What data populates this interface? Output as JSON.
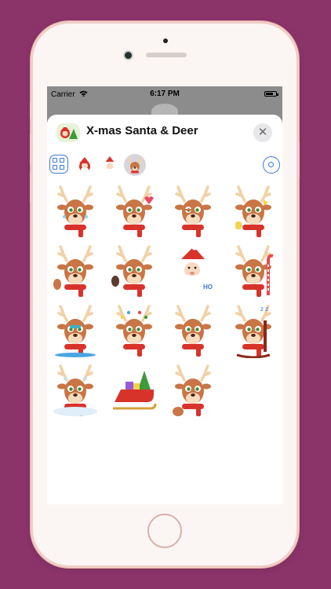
{
  "status": {
    "carrier": "Carrier",
    "time": "6:17 PM"
  },
  "app": {
    "title": "X-mas Santa & Deer",
    "close_glyph": "✕"
  },
  "toolbar": {
    "packs": [
      {
        "name": "santa-pack-icon",
        "selected": false
      },
      {
        "name": "santa-face-pack-icon",
        "selected": false
      },
      {
        "name": "deer-pack-icon",
        "selected": true
      }
    ]
  },
  "stickers": [
    {
      "variant": "deer-crying"
    },
    {
      "variant": "deer-kiss"
    },
    {
      "variant": "deer-wink"
    },
    {
      "variant": "deer-thumbs-up"
    },
    {
      "variant": "deer-waving"
    },
    {
      "variant": "deer-waving-alt"
    },
    {
      "variant": "santa-ho-ho"
    },
    {
      "variant": "deer-candy-cane"
    },
    {
      "variant": "deer-snowboarding"
    },
    {
      "variant": "deer-lights"
    },
    {
      "variant": "deer-scarf"
    },
    {
      "variant": "deer-rocking-chair"
    },
    {
      "variant": "deer-frozen"
    },
    {
      "variant": "santa-sleigh"
    },
    {
      "variant": "deer-dancing"
    }
  ],
  "colors": {
    "background": "#8a3469",
    "phone_body": "#fbf6f4",
    "accent_blue": "#3a78d8",
    "deer_brown": "#c97545",
    "scarf_red": "#d8332b",
    "antler": "#f1d2a6"
  }
}
